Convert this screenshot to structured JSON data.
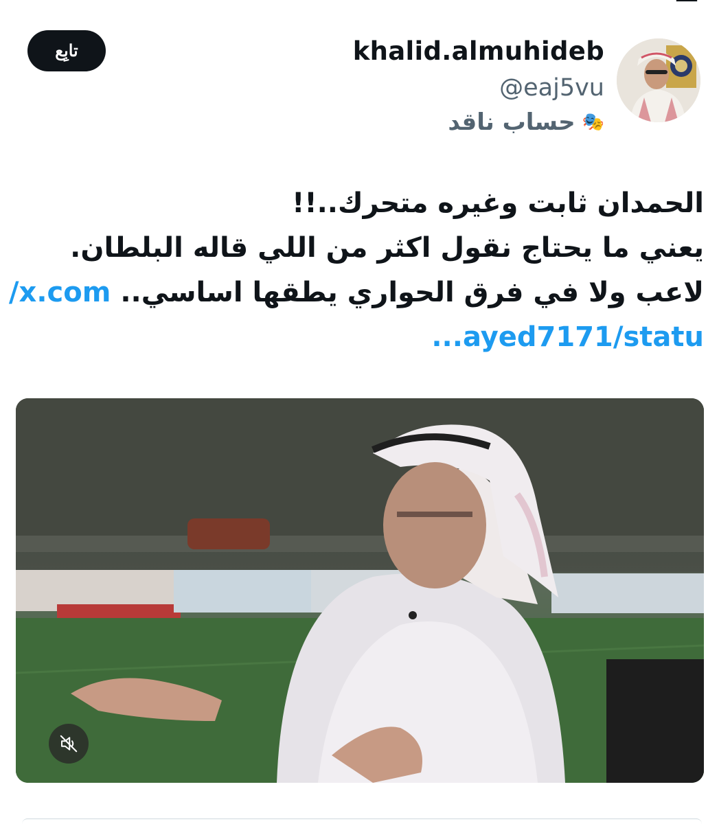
{
  "profile": {
    "display_name": "khalid.almuhideb",
    "handle": "@eaj5vu",
    "label_icon": "theater-masks-icon",
    "label_text": "حساب ناقد",
    "follow_label": "تابِع"
  },
  "tweet": {
    "lines": [
      "الحمدان ثابت وغيره متحرك..!!",
      "يعني ما يحتاج نقول اكثر من اللي قاله البلطان.",
      "لاعب ولا في فرق الحواري يطقها اساسي.."
    ],
    "link_part1": "x.com/",
    "link_part2": "ayed7171/statu..."
  },
  "media": {
    "type": "video",
    "mute_icon": "volume-muted-icon"
  },
  "colors": {
    "text": "#0f1419",
    "secondary": "#536471",
    "link": "#1d9bf0",
    "button_bg": "#0f1419"
  }
}
